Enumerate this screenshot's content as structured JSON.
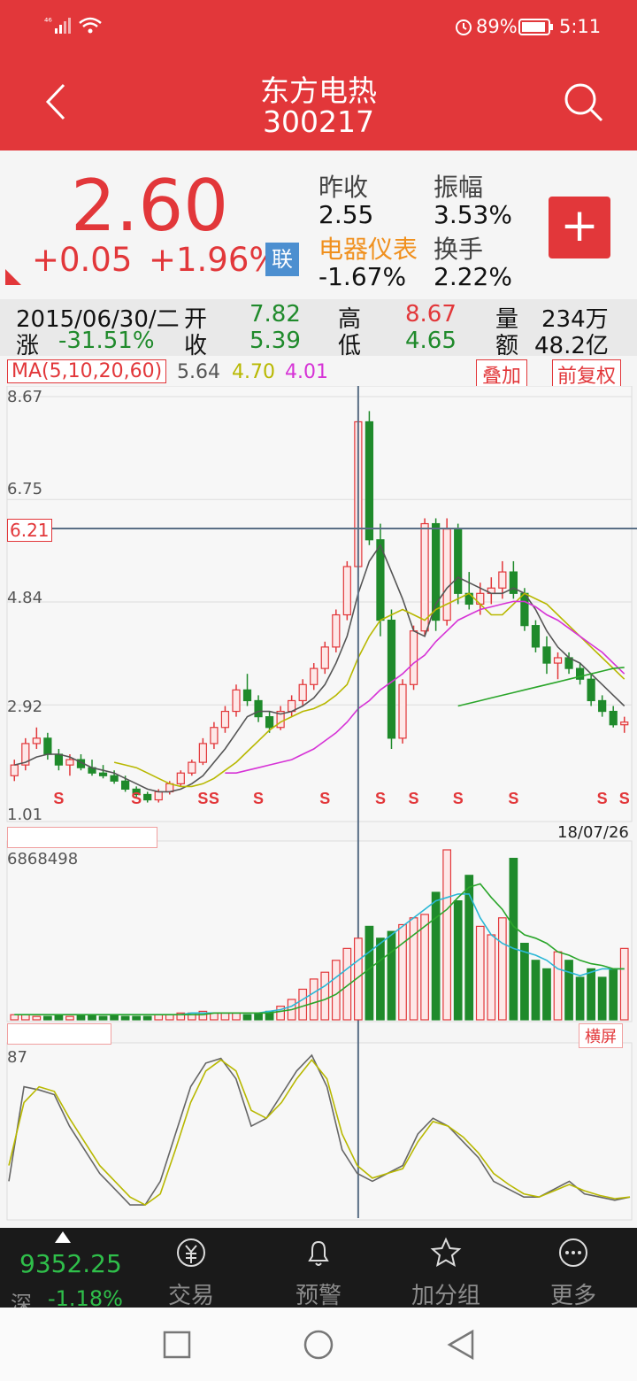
{
  "status": {
    "network": "⁴⁶",
    "battery": "89%",
    "time": "5:11"
  },
  "header": {
    "stock_name": "东方电热",
    "stock_code": "300217"
  },
  "quote": {
    "price": "2.60",
    "change": "+0.05",
    "change_pct": "+1.96%",
    "lian": "联",
    "prev_close_label": "昨收",
    "prev_close": "2.55",
    "sector": "电器仪表",
    "sector_change": "-1.67%",
    "amplitude_label": "振幅",
    "amplitude": "3.53%",
    "turnover_label": "换手",
    "turnover": "2.22%",
    "add_label": "+"
  },
  "info": {
    "date": "2015/06/30/二",
    "open_label": "开",
    "open": "7.82",
    "high_label": "高",
    "high": "8.67",
    "vol_label": "量",
    "vol": "234万",
    "chg_label": "涨",
    "chg": "-31.51%",
    "close_label": "收",
    "close": "5.39",
    "low_label": "低",
    "low": "4.65",
    "amt_label": "额",
    "amt": "48.2亿"
  },
  "ma": {
    "label": "MA(5,10,20,60)",
    "v1": "5.64",
    "v2": "4.70",
    "v3": "4.01",
    "overlay_label": "叠加",
    "adjust_label": "前复权"
  },
  "kchart": {
    "y_labels": [
      "8.67",
      "6.75",
      "4.84",
      "2.92",
      "1.01"
    ],
    "crosshair_price": "6.21",
    "date_end": "18/07/26",
    "signal": "S"
  },
  "volume": {
    "max_label": "6868498",
    "landscape_label": "横屏"
  },
  "indicator": {
    "top_label": "87"
  },
  "tabs": {
    "index_value": "9352.25",
    "index_name": "深",
    "index_change": "-1.18%",
    "items": [
      "交易",
      "预警",
      "加分组",
      "更多"
    ]
  },
  "colors": {
    "header": "#e2373a",
    "up": "#e2373a",
    "down": "#1f8a2b",
    "ma5": "#555555",
    "ma10": "#b8b800",
    "ma20": "#d633d6",
    "ma60": "#2aa52a"
  },
  "chart_data": {
    "type": "candlestick",
    "ylim": [
      1.01,
      8.67
    ],
    "candles": [
      [
        1.6,
        1.9,
        1.5,
        1.8
      ],
      [
        1.8,
        2.3,
        1.7,
        2.2
      ],
      [
        2.2,
        2.5,
        2.1,
        2.3
      ],
      [
        2.3,
        2.4,
        1.9,
        2.0
      ],
      [
        2.0,
        2.1,
        1.7,
        1.8
      ],
      [
        1.8,
        2.0,
        1.6,
        1.9
      ],
      [
        1.9,
        2.0,
        1.7,
        1.75
      ],
      [
        1.75,
        1.9,
        1.6,
        1.65
      ],
      [
        1.65,
        1.8,
        1.55,
        1.6
      ],
      [
        1.6,
        1.7,
        1.45,
        1.5
      ],
      [
        1.5,
        1.6,
        1.3,
        1.35
      ],
      [
        1.35,
        1.4,
        1.2,
        1.25
      ],
      [
        1.25,
        1.3,
        1.1,
        1.15
      ],
      [
        1.15,
        1.35,
        1.1,
        1.3
      ],
      [
        1.3,
        1.5,
        1.25,
        1.45
      ],
      [
        1.45,
        1.7,
        1.4,
        1.65
      ],
      [
        1.65,
        1.9,
        1.6,
        1.85
      ],
      [
        1.85,
        2.3,
        1.8,
        2.2
      ],
      [
        2.2,
        2.6,
        2.1,
        2.5
      ],
      [
        2.5,
        2.9,
        2.4,
        2.8
      ],
      [
        2.8,
        3.3,
        2.7,
        3.2
      ],
      [
        3.2,
        3.5,
        2.9,
        3.0
      ],
      [
        3.0,
        3.1,
        2.6,
        2.7
      ],
      [
        2.7,
        2.8,
        2.4,
        2.5
      ],
      [
        2.5,
        2.9,
        2.45,
        2.8
      ],
      [
        2.8,
        3.1,
        2.7,
        3.0
      ],
      [
        3.0,
        3.4,
        2.9,
        3.3
      ],
      [
        3.3,
        3.7,
        3.2,
        3.6
      ],
      [
        3.6,
        4.1,
        3.5,
        4.0
      ],
      [
        4.0,
        4.7,
        3.9,
        4.6
      ],
      [
        4.6,
        5.6,
        4.5,
        5.5
      ],
      [
        5.5,
        8.5,
        5.3,
        8.2
      ],
      [
        8.2,
        8.4,
        5.9,
        6.0
      ],
      [
        6.0,
        6.3,
        4.2,
        4.5
      ],
      [
        4.5,
        4.7,
        2.1,
        2.3
      ],
      [
        2.3,
        3.4,
        2.2,
        3.3
      ],
      [
        3.3,
        4.4,
        3.2,
        4.3
      ],
      [
        4.3,
        6.4,
        4.2,
        6.3
      ],
      [
        6.3,
        6.4,
        4.3,
        4.5
      ],
      [
        4.5,
        6.4,
        4.4,
        6.2
      ],
      [
        6.2,
        6.3,
        4.8,
        5.0
      ],
      [
        5.0,
        5.4,
        4.7,
        4.8
      ],
      [
        4.8,
        5.2,
        4.6,
        5.0
      ],
      [
        5.0,
        5.3,
        4.8,
        5.1
      ],
      [
        5.1,
        5.6,
        4.9,
        5.4
      ],
      [
        5.4,
        5.6,
        4.9,
        5.0
      ],
      [
        5.0,
        5.1,
        4.3,
        4.4
      ],
      [
        4.4,
        4.5,
        3.9,
        4.0
      ],
      [
        4.0,
        4.2,
        3.5,
        3.7
      ],
      [
        3.7,
        3.9,
        3.4,
        3.8
      ],
      [
        3.8,
        3.9,
        3.5,
        3.6
      ],
      [
        3.6,
        3.7,
        3.3,
        3.4
      ],
      [
        3.4,
        3.5,
        2.9,
        3.0
      ],
      [
        3.0,
        3.1,
        2.7,
        2.8
      ],
      [
        2.8,
        2.9,
        2.5,
        2.55
      ],
      [
        2.55,
        2.7,
        2.4,
        2.6
      ]
    ],
    "ma5": [
      1.8,
      1.85,
      1.95,
      2.0,
      2.0,
      1.95,
      1.85,
      1.75,
      1.7,
      1.65,
      1.55,
      1.45,
      1.35,
      1.3,
      1.3,
      1.35,
      1.45,
      1.6,
      1.85,
      2.1,
      2.4,
      2.7,
      2.8,
      2.8,
      2.75,
      2.8,
      2.9,
      3.05,
      3.3,
      3.7,
      4.2,
      5.0,
      5.6,
      5.9,
      5.4,
      4.9,
      4.3,
      4.2,
      4.8,
      5.1,
      5.3,
      5.2,
      5.1,
      5.0,
      5.0,
      5.1,
      5.0,
      4.7,
      4.3,
      4.0,
      3.8,
      3.7,
      3.5,
      3.3,
      3.1,
      2.9
    ],
    "ma10": [
      null,
      null,
      null,
      null,
      null,
      null,
      null,
      null,
      null,
      1.85,
      1.8,
      1.75,
      1.65,
      1.55,
      1.45,
      1.4,
      1.4,
      1.45,
      1.55,
      1.7,
      1.85,
      2.05,
      2.25,
      2.45,
      2.6,
      2.7,
      2.8,
      2.85,
      2.95,
      3.1,
      3.3,
      3.8,
      4.2,
      4.5,
      4.6,
      4.7,
      4.6,
      4.5,
      4.7,
      4.8,
      4.9,
      5.0,
      4.8,
      4.6,
      4.6,
      4.8,
      5.0,
      4.9,
      4.8,
      4.6,
      4.4,
      4.2,
      4.0,
      3.8,
      3.6,
      3.4
    ],
    "ma20": [
      null,
      null,
      null,
      null,
      null,
      null,
      null,
      null,
      null,
      null,
      null,
      null,
      null,
      null,
      null,
      null,
      null,
      null,
      null,
      1.65,
      1.65,
      1.7,
      1.75,
      1.8,
      1.85,
      1.9,
      2.0,
      2.1,
      2.25,
      2.4,
      2.6,
      2.85,
      3.0,
      3.2,
      3.35,
      3.5,
      3.7,
      3.85,
      4.1,
      4.3,
      4.5,
      4.6,
      4.7,
      4.75,
      4.8,
      4.85,
      4.85,
      4.75,
      4.6,
      4.5,
      4.35,
      4.2,
      4.05,
      3.9,
      3.7,
      3.5
    ],
    "ma60": [
      null,
      null,
      null,
      null,
      null,
      null,
      null,
      null,
      null,
      null,
      null,
      null,
      null,
      null,
      null,
      null,
      null,
      null,
      null,
      null,
      null,
      null,
      null,
      null,
      null,
      null,
      null,
      null,
      null,
      null,
      null,
      null,
      null,
      null,
      null,
      null,
      null,
      null,
      null,
      null,
      2.9,
      2.95,
      3.0,
      3.05,
      3.1,
      3.15,
      3.2,
      3.25,
      3.3,
      3.35,
      3.4,
      3.45,
      3.5,
      3.55,
      3.6,
      3.62
    ],
    "signals": [
      4,
      11,
      17,
      18,
      22,
      28,
      33,
      36,
      40,
      45,
      53,
      55
    ],
    "volumes": [
      0.03,
      0.03,
      0.02,
      0.02,
      0.03,
      0.02,
      0.03,
      0.03,
      0.02,
      0.03,
      0.02,
      0.02,
      0.02,
      0.03,
      0.03,
      0.04,
      0.04,
      0.05,
      0.04,
      0.04,
      0.04,
      0.03,
      0.04,
      0.05,
      0.08,
      0.12,
      0.18,
      0.24,
      0.28,
      0.35,
      0.42,
      0.48,
      0.55,
      0.48,
      0.52,
      0.56,
      0.6,
      0.62,
      0.75,
      1.0,
      0.7,
      0.85,
      0.55,
      0.5,
      0.6,
      0.95,
      0.45,
      0.35,
      0.3,
      0.4,
      0.35,
      0.25,
      0.3,
      0.25,
      0.3,
      0.42
    ],
    "vol_ma1": [
      0.03,
      0.03,
      0.03,
      0.03,
      0.03,
      0.03,
      0.03,
      0.03,
      0.03,
      0.03,
      0.03,
      0.03,
      0.03,
      0.03,
      0.03,
      0.03,
      0.04,
      0.04,
      0.04,
      0.04,
      0.04,
      0.04,
      0.04,
      0.05,
      0.06,
      0.08,
      0.12,
      0.16,
      0.2,
      0.25,
      0.3,
      0.35,
      0.4,
      0.45,
      0.5,
      0.55,
      0.6,
      0.65,
      0.7,
      0.72,
      0.74,
      0.74,
      0.6,
      0.5,
      0.45,
      0.42,
      0.4,
      0.38,
      0.35,
      0.3,
      0.28,
      0.26,
      0.28,
      0.3,
      0.3,
      0.3
    ],
    "vol_ma2": [
      0.03,
      0.03,
      0.03,
      0.03,
      0.03,
      0.03,
      0.03,
      0.03,
      0.03,
      0.03,
      0.03,
      0.03,
      0.03,
      0.03,
      0.03,
      0.03,
      0.03,
      0.03,
      0.04,
      0.04,
      0.04,
      0.04,
      0.04,
      0.04,
      0.05,
      0.06,
      0.08,
      0.1,
      0.12,
      0.15,
      0.2,
      0.25,
      0.3,
      0.35,
      0.4,
      0.45,
      0.5,
      0.55,
      0.6,
      0.65,
      0.72,
      0.78,
      0.8,
      0.72,
      0.65,
      0.55,
      0.5,
      0.48,
      0.45,
      0.4,
      0.38,
      0.35,
      0.33,
      0.32,
      0.3,
      0.3
    ],
    "kdj_k": [
      0.2,
      0.8,
      0.78,
      0.75,
      0.55,
      0.4,
      0.25,
      0.15,
      0.05,
      0.05,
      0.2,
      0.5,
      0.8,
      0.95,
      0.98,
      0.85,
      0.55,
      0.6,
      0.75,
      0.9,
      1.0,
      0.8,
      0.4,
      0.25,
      0.2,
      0.25,
      0.3,
      0.5,
      0.6,
      0.55,
      0.45,
      0.35,
      0.2,
      0.15,
      0.1,
      0.1,
      0.15,
      0.2,
      0.12,
      0.1,
      0.08,
      0.1
    ],
    "kdj_d": [
      0.3,
      0.7,
      0.8,
      0.77,
      0.6,
      0.45,
      0.3,
      0.2,
      0.1,
      0.05,
      0.12,
      0.4,
      0.7,
      0.9,
      0.97,
      0.9,
      0.65,
      0.6,
      0.7,
      0.85,
      0.97,
      0.85,
      0.5,
      0.3,
      0.22,
      0.25,
      0.28,
      0.45,
      0.58,
      0.55,
      0.48,
      0.38,
      0.25,
      0.18,
      0.12,
      0.1,
      0.14,
      0.18,
      0.14,
      0.11,
      0.09,
      0.1
    ]
  }
}
